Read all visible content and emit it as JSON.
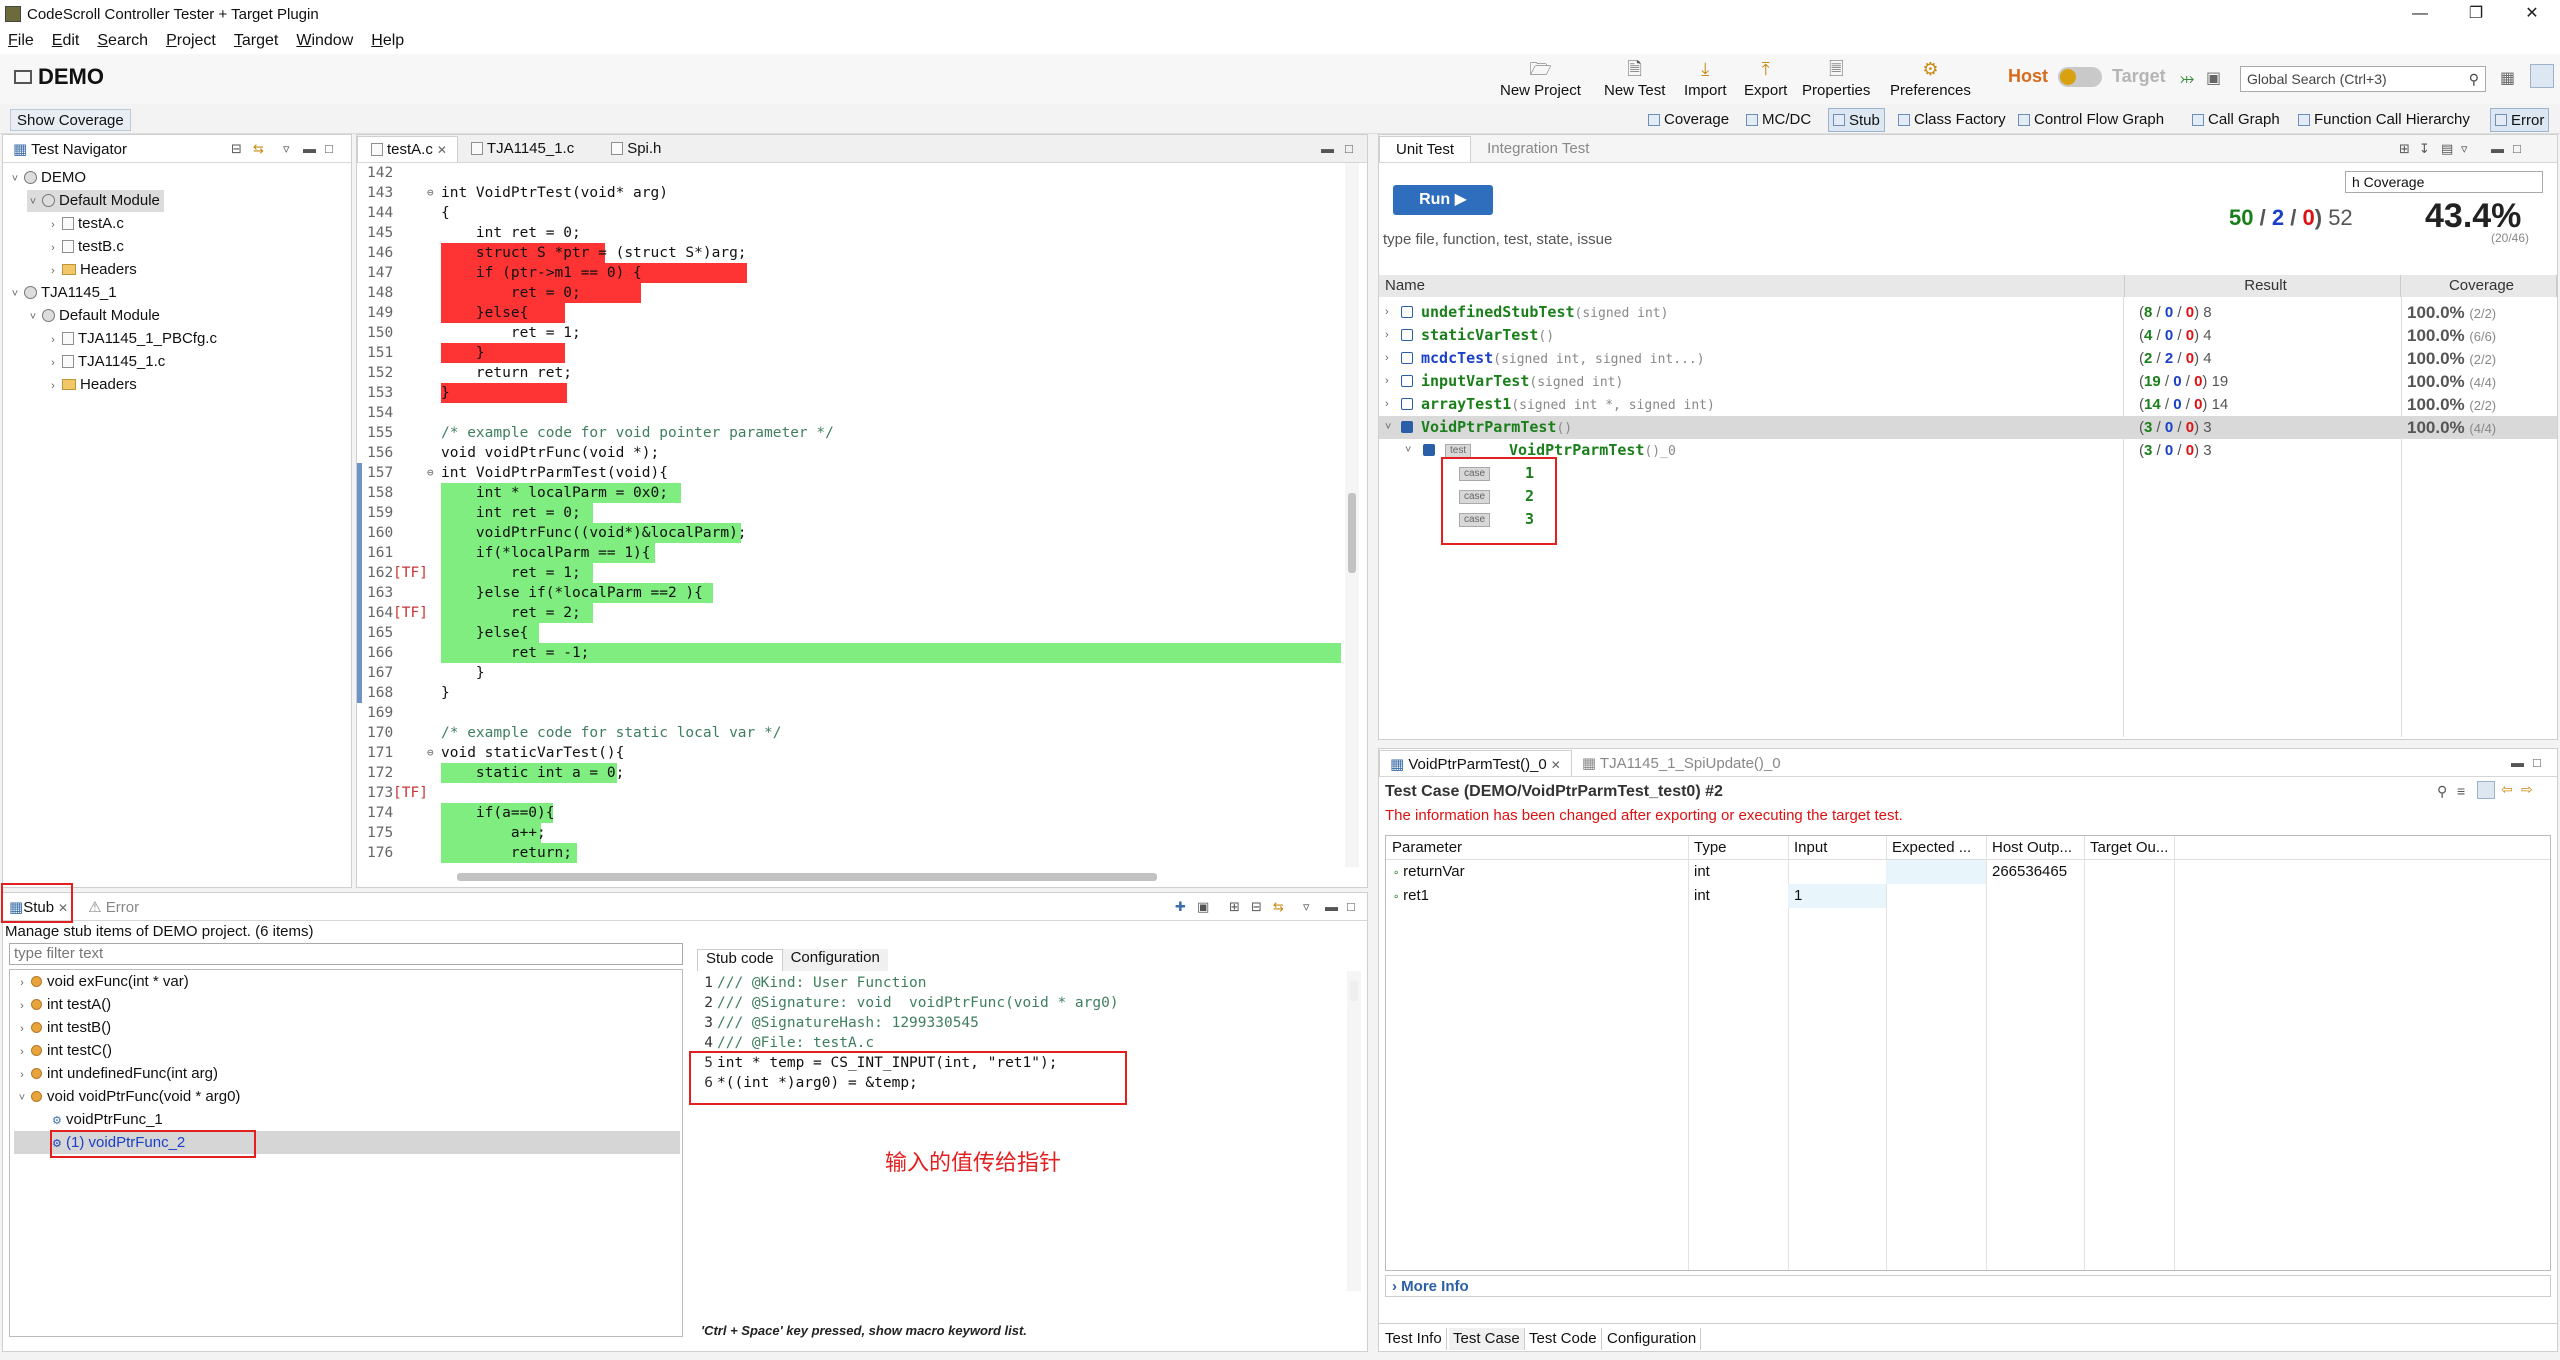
{
  "window": {
    "title": "CodeScroll Controller Tester + Target Plugin"
  },
  "menu": [
    "File",
    "Edit",
    "Search",
    "Project",
    "Target",
    "Window",
    "Help"
  ],
  "toolbar": {
    "project": "DEMO",
    "buttons": [
      "New Project",
      "New Test",
      "Import",
      "Export",
      "Properties",
      "Preferences"
    ],
    "host": "Host",
    "target": "Target",
    "search_placeholder": "Global Search (Ctrl+3)"
  },
  "views": {
    "show_coverage": "Show Coverage",
    "items": [
      "Coverage",
      "MC/DC",
      "Stub",
      "Class Factory",
      "Control Flow Graph",
      "Call Graph",
      "Function Call Hierarchy",
      "Error"
    ]
  },
  "navigator": {
    "title": "Test Navigator",
    "rows": [
      {
        "label": "DEMO",
        "level": 0,
        "kind": "project"
      },
      {
        "label": "Default Module",
        "level": 1,
        "kind": "module"
      },
      {
        "label": "testA.c",
        "level": 2,
        "kind": "file"
      },
      {
        "label": "testB.c",
        "level": 2,
        "kind": "file"
      },
      {
        "label": "Headers",
        "level": 2,
        "kind": "folder"
      },
      {
        "label": "TJA1145_1",
        "level": 0,
        "kind": "project"
      },
      {
        "label": "Default Module",
        "level": 1,
        "kind": "module"
      },
      {
        "label": "TJA1145_1_PBCfg.c",
        "level": 2,
        "kind": "file"
      },
      {
        "label": "TJA1145_1.c",
        "level": 2,
        "kind": "file"
      },
      {
        "label": "Headers",
        "level": 2,
        "kind": "folder"
      }
    ]
  },
  "editor": {
    "tabs": [
      "testA.c",
      "TJA1145_1.c",
      "Spi.h"
    ],
    "line_numbers": [
      "142",
      "143",
      "144",
      "145",
      "146",
      "147",
      "148",
      "149",
      "150",
      "151",
      "152",
      "153",
      "154",
      "155",
      "156",
      "157",
      "158",
      "159",
      "160",
      "161",
      "162",
      "163",
      "164",
      "165",
      "166",
      "167",
      "168",
      "169",
      "170",
      "171",
      "172",
      "173",
      "174",
      "175",
      "176"
    ],
    "tf_marker": "[TF]",
    "lines": [
      "",
      "int VoidPtrTest(void* arg)",
      "{",
      "    int ret = 0;",
      "    struct S *ptr = (struct S*)arg;",
      "    if (ptr->m1 == 0) {",
      "        ret = 0;",
      "    }else{",
      "        ret = 1;",
      "    }",
      "    return ret;",
      "}",
      "",
      "/* example code for void pointer parameter */",
      "void voidPtrFunc(void *);",
      "int VoidPtrParmTest(void){",
      "    int * localParm = 0x0;",
      "    int ret = 0;",
      "    voidPtrFunc((void*)&localParm);",
      "    if(*localParm == 1){",
      "        ret = 1;",
      "    }else if(*localParm ==2 ){",
      "        ret = 2;",
      "    }else{",
      "        ret = -1;",
      "    }",
      "}",
      "",
      "/* example code for static local var */",
      "void staticVarTest(){",
      "    static int a = 0;",
      "",
      "    if(a==0){",
      "        a++;",
      "        return;"
    ]
  },
  "unit_test": {
    "tabs": [
      "Unit Test",
      "Integration Test"
    ],
    "run": "Run",
    "coverage_label": "h Coverage",
    "summary": {
      "passed": "50",
      "b": "2",
      "f": "0",
      "total": "52",
      "pct": "43.4%",
      "frac": "(20/46)"
    },
    "filter_placeholder": "type file, function, test, state, issue",
    "columns": [
      "Name",
      "Result",
      "Coverage"
    ],
    "rows": [
      {
        "name": "undefinedStubTest",
        "sig": "(signed int)",
        "p": "8",
        "b": "0",
        "f": "0",
        "t": "8",
        "cov": "100.0%",
        "frac": "(2/2)"
      },
      {
        "name": "staticVarTest",
        "sig": "()",
        "p": "4",
        "b": "0",
        "f": "0",
        "t": "4",
        "cov": "100.0%",
        "frac": "(6/6)"
      },
      {
        "name": "mcdcTest",
        "sig": "(signed int, signed int...)",
        "p": "2",
        "b": "2",
        "f": "0",
        "t": "4",
        "cov": "100.0%",
        "frac": "(2/2)"
      },
      {
        "name": "inputVarTest",
        "sig": "(signed int)",
        "p": "19",
        "b": "0",
        "f": "0",
        "t": "19",
        "cov": "100.0%",
        "frac": "(4/4)"
      },
      {
        "name": "arrayTest1",
        "sig": "(signed int *, signed int)",
        "p": "14",
        "b": "0",
        "f": "0",
        "t": "14",
        "cov": "100.0%",
        "frac": "(2/2)"
      },
      {
        "name": "VoidPtrParmTest",
        "sig": "()",
        "p": "3",
        "b": "0",
        "f": "0",
        "t": "3",
        "cov": "100.0%",
        "frac": "(4/4)"
      }
    ],
    "child": {
      "badge": "test",
      "name": "VoidPtrParmTest",
      "suffix": "()_0",
      "p": "3",
      "b": "0",
      "f": "0",
      "t": "3"
    },
    "case_badge": "case",
    "cases": [
      "1",
      "2",
      "3"
    ]
  },
  "test_case": {
    "tabs": [
      "VoidPtrParmTest()_0",
      "TJA1145_1_SpiUpdate()_0"
    ],
    "title": "Test Case (DEMO/VoidPtrParmTest_test0) #2",
    "warning": "The information has been changed after exporting or executing the target test.",
    "columns": [
      "Parameter",
      "Type",
      "Input",
      "Expected ...",
      "Host Outp...",
      "Target Ou..."
    ],
    "rows": [
      {
        "param": "returnVar",
        "type": "int",
        "input": "",
        "expected": "",
        "host": "266536465",
        "target": ""
      },
      {
        "param": "ret1",
        "type": "int",
        "input": "1",
        "expected": "",
        "host": "",
        "target": ""
      }
    ],
    "more_info": "More Info",
    "bottom_tabs": [
      "Test Info",
      "Test Case",
      "Test Code",
      "Configuration"
    ]
  },
  "stub": {
    "tabs": [
      "Stub",
      "Error"
    ],
    "subtitle": "Manage stub items of DEMO project. (6 items)",
    "filter_placeholder": "type filter text",
    "items": [
      "void  exFunc(int * var)",
      "int  testA()",
      "int  testB()",
      "int  testC()",
      "int  undefinedFunc(int arg)",
      "void  voidPtrFunc(void * arg0)"
    ],
    "children": [
      "voidPtrFunc_1",
      "(1) voidPtrFunc_2"
    ],
    "code_tabs": [
      "Stub code",
      "Configuration"
    ],
    "code_lines": [
      "/// @Kind: User Function",
      "/// @Signature: void  voidPtrFunc(void * arg0)",
      "/// @SignatureHash: 1299330545",
      "/// @File: testA.c",
      "int * temp = CS_INT_INPUT(int, \"ret1\");",
      "*((int *)arg0) = &temp;"
    ],
    "code_line_numbers": [
      "1",
      "2",
      "3",
      "4",
      "5",
      "6"
    ],
    "annotation": "输入的值传给指针",
    "hint": "'Ctrl + Space' key pressed, show macro keyword list."
  }
}
